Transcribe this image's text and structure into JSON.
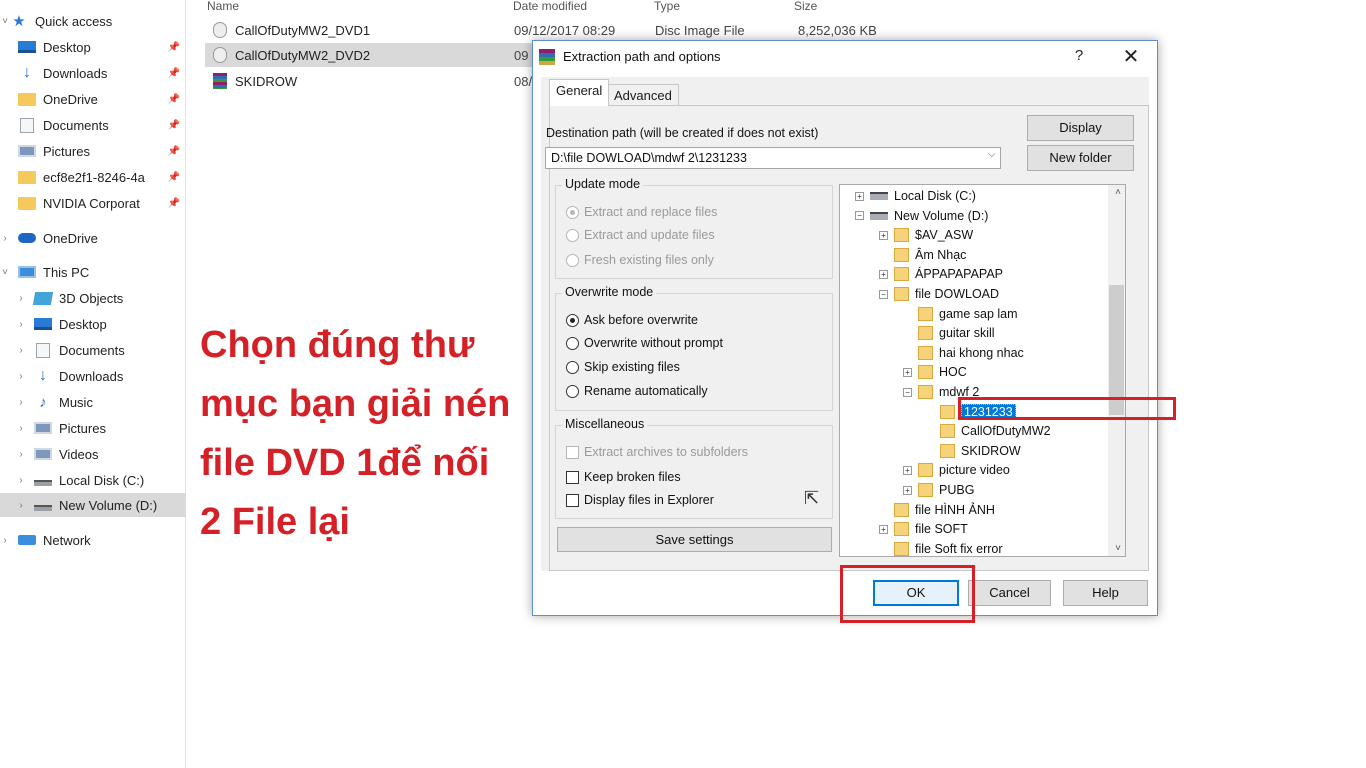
{
  "explorer": {
    "columns": {
      "name": "Name",
      "date": "Date modified",
      "type": "Type",
      "size": "Size"
    },
    "nav": {
      "quick_access": "Quick access",
      "pinned": [
        "Desktop",
        "Downloads",
        "OneDrive",
        "Documents",
        "Pictures",
        "ecf8e2f1-8246-4a",
        "NVIDIA Corporat"
      ],
      "onedrive": "OneDrive",
      "this_pc": "This PC",
      "pc_items": [
        "3D Objects",
        "Desktop",
        "Documents",
        "Downloads",
        "Music",
        "Pictures",
        "Videos",
        "Local Disk (C:)",
        "New Volume (D:)"
      ],
      "network": "Network",
      "pin_glyph": "📌"
    },
    "files": [
      {
        "name": "CallOfDutyMW2_DVD1",
        "date": "09/12/2017 08:29",
        "type": "Disc Image File",
        "size": "8,252,036 KB",
        "icon": "disc-image-icon"
      },
      {
        "name": "CallOfDutyMW2_DVD2",
        "date": "09",
        "type": "",
        "size": "",
        "icon": "disc-image-icon"
      },
      {
        "name": "SKIDROW",
        "date": "08/",
        "type": "",
        "size": "",
        "icon": "winrar-archive-icon"
      }
    ]
  },
  "dialog": {
    "title": "Extraction path and options",
    "help_glyph": "?",
    "close_glyph": "✕",
    "tabs": [
      "General",
      "Advanced"
    ],
    "destination_label": "Destination path (will be created if does not exist)",
    "destination_value": "D:\\file DOWLOAD\\mdwf 2\\1231233",
    "dropdown_glyph": "⌵",
    "buttons": {
      "display": "Display",
      "new_folder": "New folder",
      "save_settings": "Save settings",
      "ok": "OK",
      "cancel": "Cancel",
      "help": "Help"
    },
    "update_mode": {
      "title": "Update mode",
      "options": [
        "Extract and replace files",
        "Extract and update files",
        "Fresh existing files only"
      ]
    },
    "overwrite_mode": {
      "title": "Overwrite mode",
      "options": [
        "Ask before overwrite",
        "Overwrite without prompt",
        "Skip existing files",
        "Rename automatically"
      ]
    },
    "misc": {
      "title": "Miscellaneous",
      "options": [
        "Extract archives to subfolders",
        "Keep broken files",
        "Display files in Explorer"
      ]
    },
    "tree": [
      {
        "label": "Local Disk (C:)",
        "kind": "disk",
        "expander": "+"
      },
      {
        "label": "New Volume (D:)",
        "kind": "disk",
        "expander": "−"
      },
      {
        "label": "$AV_ASW",
        "kind": "folder",
        "expander": "+"
      },
      {
        "label": "Âm Nhạc",
        "kind": "folder",
        "expander": ""
      },
      {
        "label": "ÁPPAPAPAPAP",
        "kind": "folder",
        "expander": "+"
      },
      {
        "label": "file DOWLOAD",
        "kind": "folder",
        "expander": "−"
      },
      {
        "label": "game sap lam",
        "kind": "folder",
        "expander": ""
      },
      {
        "label": "guitar skill",
        "kind": "folder",
        "expander": ""
      },
      {
        "label": "hai khong nhac",
        "kind": "folder",
        "expander": ""
      },
      {
        "label": "HOC",
        "kind": "folder",
        "expander": "+"
      },
      {
        "label": "mdwf 2",
        "kind": "folder",
        "expander": "−"
      },
      {
        "label": "1231233",
        "kind": "folder",
        "expander": ""
      },
      {
        "label": "CallOfDutyMW2",
        "kind": "folder",
        "expander": ""
      },
      {
        "label": "SKIDROW",
        "kind": "folder",
        "expander": ""
      },
      {
        "label": "picture video",
        "kind": "folder",
        "expander": "+"
      },
      {
        "label": "PUBG",
        "kind": "folder",
        "expander": "+"
      },
      {
        "label": "file HÌNH ẢNH",
        "kind": "folder",
        "expander": ""
      },
      {
        "label": "file SOFT",
        "kind": "folder",
        "expander": "+"
      },
      {
        "label": "file Soft fix error",
        "kind": "folder",
        "expander": ""
      }
    ],
    "scroll_up": "˄",
    "scroll_down": "˅"
  },
  "caption": [
    "Chọn đúng thư",
    " mục bạn giải nén",
    " file DVD 1để nối",
    " 2 File lại"
  ],
  "colors": {
    "accent": "#0078d7",
    "annotation_red": "#d42027"
  }
}
